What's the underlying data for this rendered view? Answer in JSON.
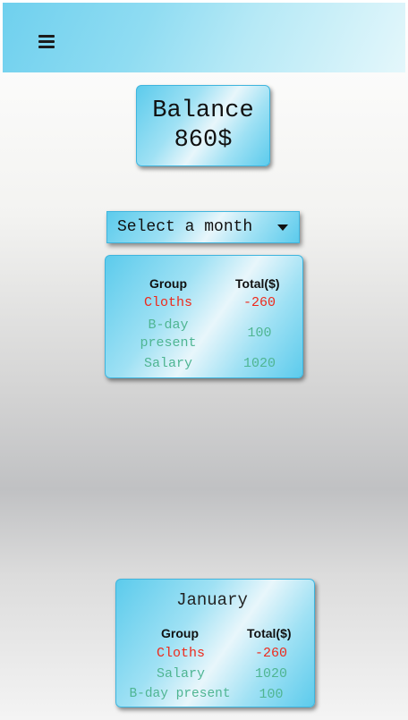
{
  "header": {
    "menu_icon": "hamburger-menu-icon"
  },
  "balance": {
    "label": "Balance",
    "amount": "860$"
  },
  "month_select": {
    "label": "Select a month"
  },
  "summary_table": {
    "headers": [
      "Group",
      "Total($)"
    ],
    "rows": [
      {
        "group": "Cloths",
        "total": "-260",
        "type": "expense"
      },
      {
        "group_line1": "B-day",
        "group_line2": "present",
        "total": "100",
        "type": "income"
      },
      {
        "group": "Salary",
        "total": "1020",
        "type": "income"
      }
    ]
  },
  "month_card": {
    "title": "January",
    "headers": [
      "Group",
      "Total($)"
    ],
    "rows": [
      {
        "group": "Cloths",
        "total": "-260",
        "type": "expense"
      },
      {
        "group": "Salary",
        "total": "1020",
        "type": "income"
      },
      {
        "group": "B-day present",
        "total": "100",
        "type": "income"
      }
    ]
  },
  "colors": {
    "expense": "#ee2a1c",
    "income": "#4fb592",
    "accent": "#5ccbec"
  }
}
